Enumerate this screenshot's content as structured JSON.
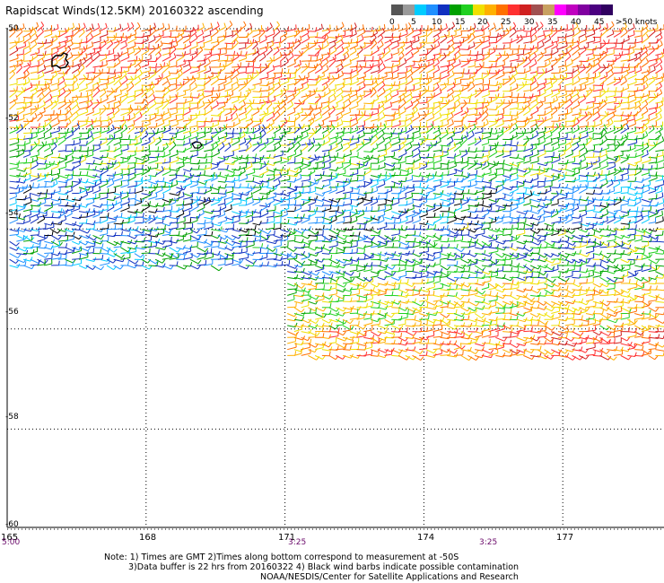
{
  "title": "Rapidscat Winds(12.5KM) 20160322 ascending",
  "legend": {
    "colors": [
      "#555555",
      "#9a9a9a",
      "#00ccff",
      "#1f8fff",
      "#1030c0",
      "#00a000",
      "#20d020",
      "#f0e000",
      "#ffb000",
      "#ff7000",
      "#ff3030",
      "#d02020",
      "#a05050",
      "#c8a060",
      "#ff00ff",
      "#c000c0",
      "#8000a0",
      "#4b0080",
      "#300060"
    ],
    "labels": [
      "0",
      "5",
      "10",
      "15",
      "20",
      "25",
      "30",
      "35",
      "40",
      "45",
      ">50 knots"
    ],
    "unit": "knots"
  },
  "axes": {
    "lat_labels": [
      "-50",
      "-52",
      "-54",
      "-56",
      "-58",
      "-60"
    ],
    "lon_labels": [
      "165",
      "168",
      "171",
      "174",
      "177"
    ],
    "time_labels": [
      "5:00",
      "3:25",
      "3:25"
    ]
  },
  "notes": {
    "line1": "Note: 1) Times are GMT 2)Times along bottom correspond to measurement at -50S",
    "line2": "3)Data buffer is 22 hrs from 20160322 4) Black wind barbs indicate possible contamination",
    "line3": "NOAA/NESDIS/Center for Satellite Applications and Research"
  },
  "map": {
    "swath1": {
      "lon_range": [
        165,
        171
      ],
      "lat_range": [
        -50,
        -54.8
      ]
    },
    "swath2": {
      "lon_range": [
        171,
        179.3
      ],
      "lat_range": [
        -50,
        -56.6
      ]
    },
    "wind_bands": [
      {
        "lat": [
          -50,
          -51
        ],
        "speed_knots": 25
      },
      {
        "lat": [
          -51,
          -52
        ],
        "speed_knots": 22
      },
      {
        "lat": [
          -52,
          -53
        ],
        "speed_knots": 15
      },
      {
        "lat": [
          -53,
          -54
        ],
        "speed_knots": 10
      },
      {
        "lat": [
          -54,
          -55
        ],
        "speed_knots": 12
      },
      {
        "lat": [
          -55,
          -56
        ],
        "speed_knots": 18
      },
      {
        "lat": [
          -56,
          -56.6
        ],
        "speed_knots": 22
      }
    ]
  }
}
